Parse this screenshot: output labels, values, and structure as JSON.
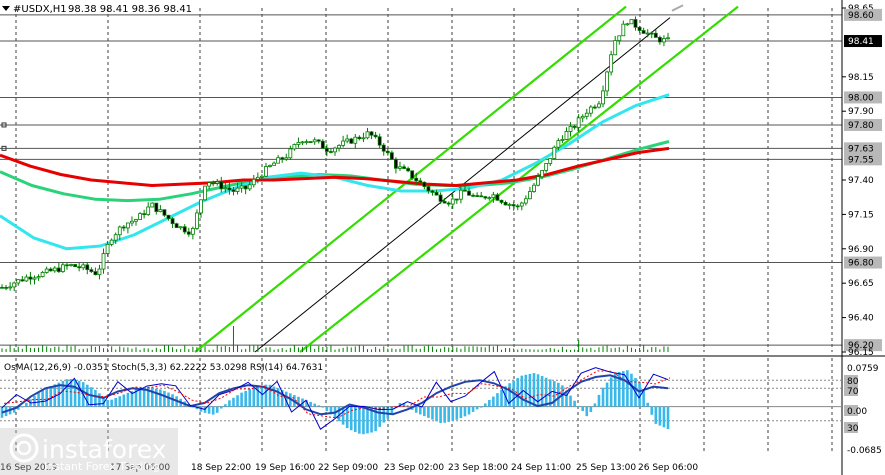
{
  "header": {
    "symbol": "#USDX,H1",
    "ohlc": "98.38 98.41 98.36 98.41"
  },
  "osma_label": "OsMA(12,26,9) -0.0351  Stoch(5,3,3) 62.2222 53.0298  RSI(14) 64.7631",
  "watermark": {
    "brand": "instaforex",
    "tagline": "Instant Forex Trading"
  },
  "colors": {
    "background": "#ffffff",
    "candles": "#008000",
    "ma_red": "#e60000",
    "ma_green": "#2ad27a",
    "ma_cyan": "#33e6ee",
    "channel": "#33dd00",
    "channel_mid": "#000000",
    "osma_bars": "#39b8ea",
    "stoch_main": "#0000cc",
    "stoch_signal": "#ff0000",
    "rsi": "#2244aa",
    "current_price_bg": "#000000"
  },
  "chart_data": [
    {
      "type": "line",
      "panel": "price",
      "ylim": [
        96.15,
        98.65
      ],
      "y_ticks": [
        "98.65",
        "98.60",
        "98.41",
        "98.15",
        "98.00",
        "97.90",
        "97.80",
        "97.63",
        "97.55",
        "97.40",
        "97.15",
        "96.90",
        "96.80",
        "96.65",
        "96.40",
        "96.20",
        "96.15"
      ],
      "highlighted_levels": [
        98.6,
        98.41,
        98.0,
        97.8,
        97.63,
        97.55,
        96.8,
        96.2
      ],
      "current_price": 98.41,
      "x_tick_labels": [
        "16 Sep 2019",
        "17 Sep 06:00",
        "18 Sep 22:00",
        "19 Sep 16:00",
        "22 Sep 09:00",
        "23 Sep 02:00",
        "23 Sep 18:00",
        "24 Sep 11:00",
        "25 Sep 13:00",
        "26 Sep 06:00"
      ],
      "series": [
        {
          "role": "close",
          "values": [
            96.62,
            96.66,
            96.7,
            96.72,
            96.75,
            96.78,
            96.76,
            96.72,
            96.98,
            97.08,
            97.12,
            97.22,
            97.14,
            97.06,
            97.02,
            97.4,
            97.36,
            97.32,
            97.34,
            97.44,
            97.52,
            97.58,
            97.7,
            97.68,
            97.62,
            97.66,
            97.7,
            97.74,
            97.64,
            97.5,
            97.44,
            97.36,
            97.28,
            97.24,
            97.32,
            97.26,
            97.3,
            97.24,
            97.2,
            97.34,
            97.5,
            97.7,
            97.78,
            97.9,
            97.98,
            98.4,
            98.56,
            98.5,
            98.43,
            98.41
          ]
        },
        {
          "role": "ma-red",
          "values": [
            97.58,
            97.5,
            97.44,
            97.4,
            97.38,
            97.36,
            97.37,
            97.38,
            97.4,
            97.4,
            97.41,
            97.42,
            97.41,
            97.39,
            97.37,
            97.36,
            97.38,
            97.4,
            97.44,
            97.5,
            97.55,
            97.6,
            97.63
          ]
        },
        {
          "role": "ma-green",
          "values": [
            97.46,
            97.36,
            97.3,
            97.26,
            97.25,
            97.26,
            97.3,
            97.35,
            97.4,
            97.42,
            97.44,
            97.43,
            97.4,
            97.37,
            97.36,
            97.36,
            97.38,
            97.42,
            97.48,
            97.55,
            97.62,
            97.68
          ]
        },
        {
          "role": "ma-cyan",
          "values": [
            97.14,
            96.98,
            96.9,
            96.92,
            97.0,
            97.12,
            97.24,
            97.34,
            97.42,
            97.45,
            97.42,
            97.36,
            97.32,
            97.32,
            97.34,
            97.4,
            97.52,
            97.66,
            97.82,
            97.94,
            98.02
          ]
        }
      ]
    },
    {
      "type": "bar",
      "panel": "oscillator",
      "ylim": [
        -0.0685,
        0.0759
      ],
      "y_ticks": [
        "0.0759",
        "80",
        "70",
        "0.00",
        "30",
        "-0.0685"
      ],
      "series": [
        {
          "role": "osma",
          "values": [
            -0.02,
            -0.01,
            0.01,
            0.03,
            0.04,
            0.05,
            0.045,
            0.03,
            0.01,
            0.02,
            0.03,
            0.035,
            0.03,
            0.02,
            0.005,
            -0.01,
            -0.015,
            0.01,
            0.025,
            0.035,
            0.04,
            0.03,
            0.02,
            0.01,
            0.0,
            -0.02,
            -0.04,
            -0.05,
            -0.045,
            -0.02,
            0.01,
            -0.01,
            -0.02,
            -0.03,
            -0.025,
            -0.015,
            0.0,
            0.02,
            0.04,
            0.055,
            0.06,
            0.05,
            0.04,
            0.01,
            -0.02,
            0.03,
            0.06,
            0.065,
            0.04,
            -0.03,
            -0.04
          ]
        },
        {
          "role": "rsi",
          "values": [
            40,
            46,
            60,
            70,
            74,
            72,
            62,
            58,
            66,
            70,
            68,
            62,
            55,
            48,
            52,
            64,
            70,
            74,
            72,
            66,
            56,
            44,
            38,
            40,
            50,
            46,
            40,
            38,
            44,
            52,
            64,
            72,
            78,
            80,
            76,
            68,
            56,
            48,
            52,
            66,
            78,
            84,
            86,
            80,
            66,
            72,
            70
          ]
        }
      ]
    }
  ]
}
